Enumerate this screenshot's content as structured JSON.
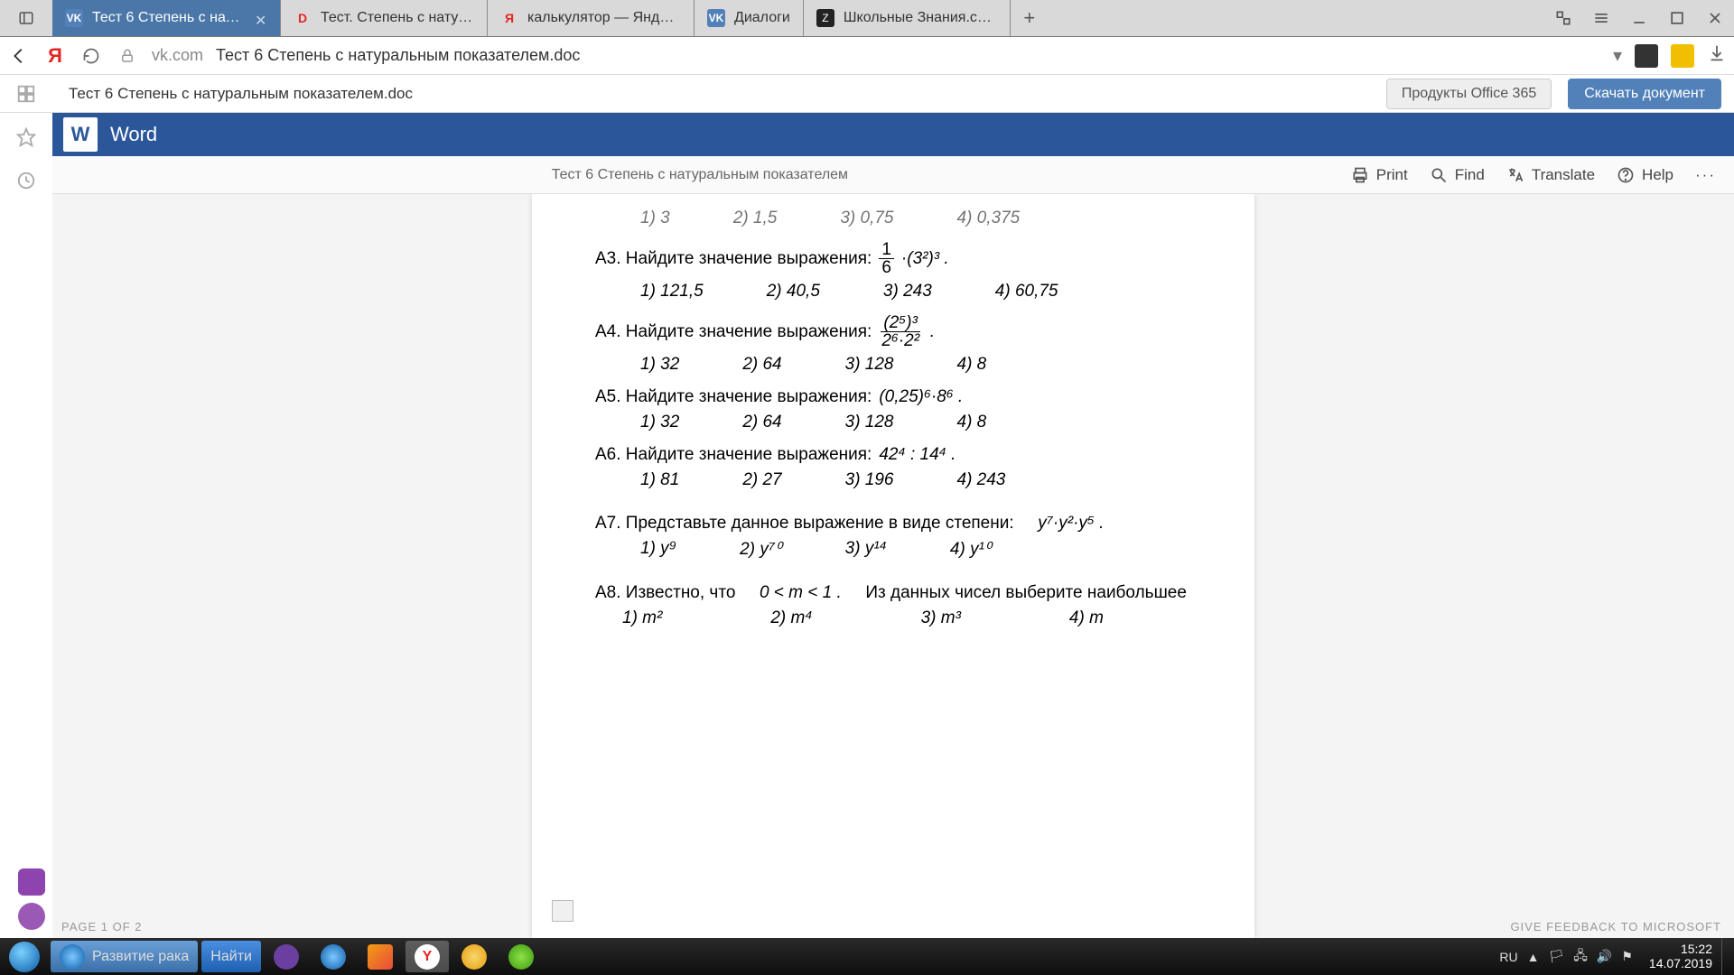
{
  "tabs": [
    {
      "label": "Тест 6 Степень с натур...",
      "favicon": "VK"
    },
    {
      "label": "Тест. Степень с натуральн",
      "favicon": "D"
    },
    {
      "label": "калькулятор — Яндекс: на",
      "favicon": "Я"
    },
    {
      "label": "Диалоги",
      "favicon": "VK"
    },
    {
      "label": "Школьные Знания.com - Р",
      "favicon": "Z"
    }
  ],
  "addr": {
    "host": "vk.com",
    "path": "Тест 6 Степень с натуральным показателем.doc"
  },
  "docbar": {
    "title": "Тест 6 Степень с натуральным показателем.doc",
    "o365": "Продукты Office 365",
    "download": "Скачать документ"
  },
  "word": {
    "app": "Word",
    "doc": "Тест 6 Степень с натуральным показателем",
    "print": "Print",
    "find": "Find",
    "translate": "Translate",
    "help": "Help"
  },
  "q_cut": {
    "o1": "1) 3",
    "o2": "2) 1,5",
    "o3": "3) 0,75",
    "o4": "4) 0,375"
  },
  "a3": {
    "q": "А3. Найдите значение выражения:",
    "expr_l": "1",
    "expr_r": "6",
    "expr2": "·(3²)³ .",
    "o1": "1) 121,5",
    "o2": "2) 40,5",
    "o3": "3) 243",
    "o4": "4) 60,75"
  },
  "a4": {
    "q": "А4. Найдите значение выражения:",
    "num": "(2⁵)³",
    "den": "2⁶·2²",
    "tail": " .",
    "o1": "1) 32",
    "o2": "2) 64",
    "o3": "3)  128",
    "o4": "4) 8"
  },
  "a5": {
    "q": "А5. Найдите значение выражения:",
    "expr": "(0,25)⁶·8⁶ .",
    "o1": "1) 32",
    "o2": "2) 64",
    "o3": "3)  128",
    "o4": "4) 8"
  },
  "a6": {
    "q": "А6. Найдите значение выражения:",
    "expr": "42⁴ : 14⁴ .",
    "o1": "1) 81",
    "o2": "2) 27",
    "o3": "3)  196",
    "o4": "4) 243"
  },
  "a7": {
    "q": "А7. Представьте данное выражение в виде степени:",
    "expr": "y⁷·y²·y⁵ .",
    "o1": "1)  y⁹",
    "o2": "2)  y⁷⁰",
    "o3": "3)  y¹⁴",
    "o4": "4)  y¹⁰"
  },
  "a8": {
    "q": "А8. Известно, что",
    "cond": "0 < m < 1 .",
    "q2": "Из данных чисел выберите наибольшее",
    "o1": "1)  m²",
    "o2": "2)  m⁴",
    "o3": "3)  m³",
    "o4": "4)  m"
  },
  "pageinfo": "PAGE 1 OF 2",
  "feedback": "GIVE FEEDBACK TO MICROSOFT",
  "taskbar": {
    "ie": "Развитие рака",
    "find": "Найти"
  },
  "tray": {
    "lang": "RU",
    "time": "15:22",
    "date": "14.07.2019"
  }
}
